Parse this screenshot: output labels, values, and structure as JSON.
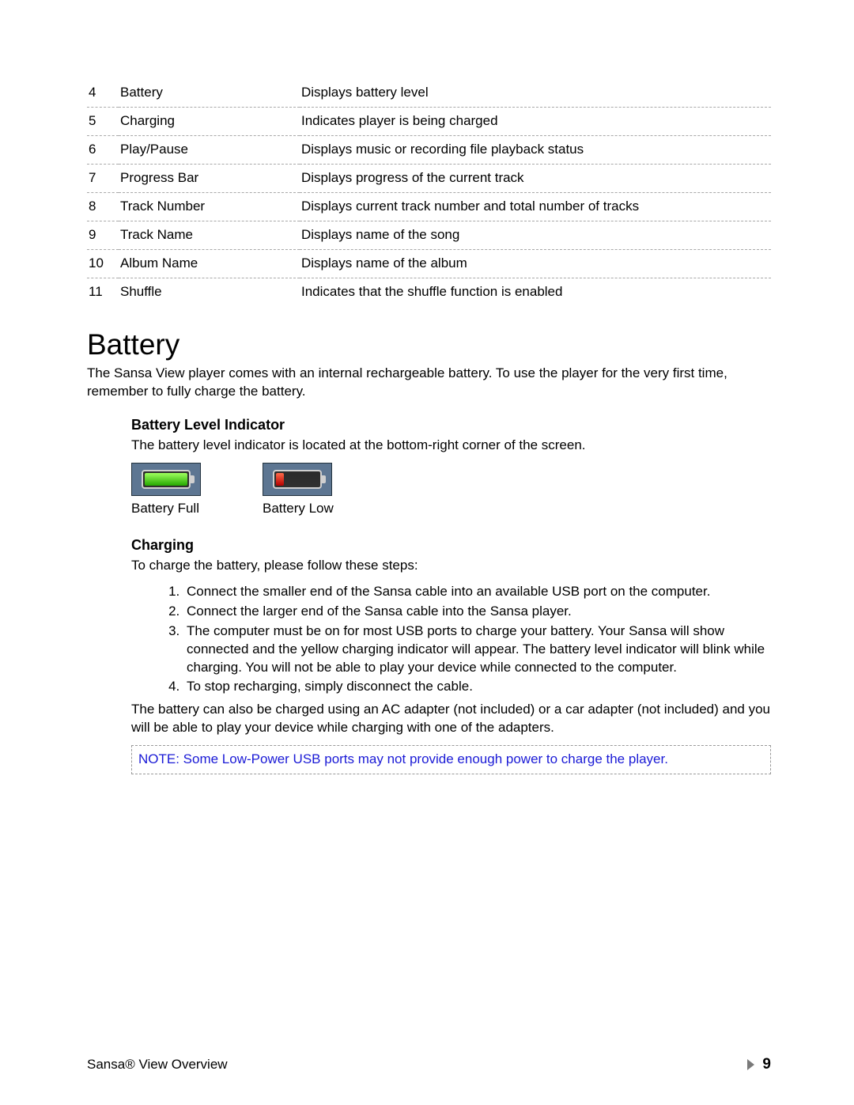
{
  "table_rows": [
    {
      "num": "4",
      "name": "Battery",
      "desc": "Displays battery level"
    },
    {
      "num": "5",
      "name": "Charging",
      "desc": "Indicates player is being charged"
    },
    {
      "num": "6",
      "name": "Play/Pause",
      "desc": "Displays music or recording file playback status"
    },
    {
      "num": "7",
      "name": "Progress Bar",
      "desc": "Displays progress of the current track"
    },
    {
      "num": "8",
      "name": "Track Number",
      "desc": "Displays current track number and total number of tracks"
    },
    {
      "num": "9",
      "name": "Track Name",
      "desc": "Displays name of the song"
    },
    {
      "num": "10",
      "name": "Album Name",
      "desc": "Displays name of the album"
    },
    {
      "num": "11",
      "name": "Shuffle",
      "desc": "Indicates that the shuffle function is enabled"
    }
  ],
  "section_title": "Battery",
  "section_intro": "The Sansa View player comes with an internal rechargeable battery.  To use the player for the very first time, remember to fully charge the battery.",
  "indicator_heading": "Battery Level Indicator",
  "indicator_body": "The battery level indicator is located at the bottom-right corner of the screen.",
  "battery_full_caption": "Battery Full",
  "battery_low_caption": "Battery Low",
  "charging_heading": "Charging",
  "charging_intro": "To charge the battery, please follow these steps:",
  "charging_steps": [
    "Connect the smaller end of the Sansa cable into an available USB port on the computer.",
    "Connect the larger end of the Sansa cable into the Sansa player.",
    "The computer must be on for most USB ports to charge your battery.  Your Sansa will show connected and the yellow charging indicator will appear.  The battery level indicator will blink while charging.  You will not be able to play your device while connected to the computer.",
    "To stop recharging, simply disconnect the cable."
  ],
  "charging_outro": "The battery can also be charged using an AC adapter (not included) or a car adapter (not included) and you will be able to play your device while charging with one of the adapters.",
  "note_text": "NOTE: Some Low-Power USB ports may not provide enough power to charge the player.",
  "footer_left": "Sansa® View Overview",
  "footer_page": "9"
}
